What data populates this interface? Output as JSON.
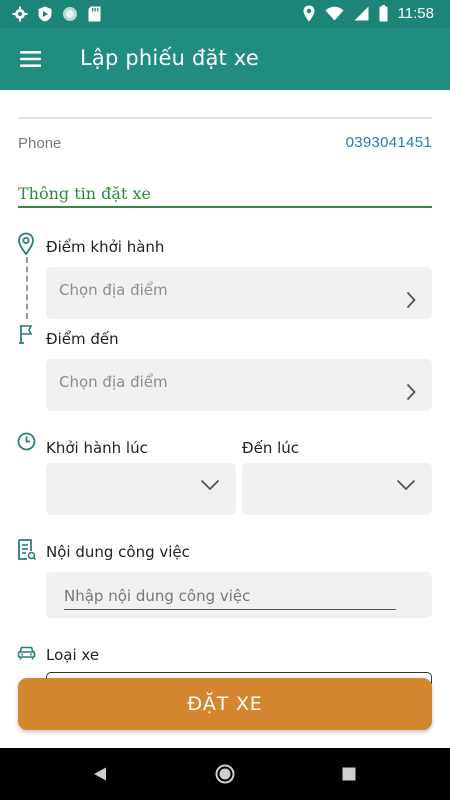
{
  "status_bar": {
    "time": "11:58",
    "icons_left": [
      "gear-icon",
      "shield-icon",
      "circle-icon",
      "sd-card-icon"
    ],
    "icons_right": [
      "location-icon",
      "wifi-icon",
      "signal-icon",
      "battery-icon"
    ]
  },
  "app_bar": {
    "title": "Lập phiếu đặt xe",
    "menu_icon": "hamburger-menu-icon"
  },
  "phone": {
    "label": "Phone",
    "value": "0393041451"
  },
  "booking_section": {
    "title": "Thông tin đặt xe"
  },
  "departure": {
    "label": "Điểm khởi hành",
    "placeholder": "Chọn địa điểm"
  },
  "destination": {
    "label": "Điểm đến",
    "placeholder": "Chọn địa điểm"
  },
  "times": {
    "depart_label": "Khởi hành lúc",
    "arrive_label": "Đến lúc"
  },
  "task": {
    "label": "Nội dung công việc",
    "placeholder": "Nhập nội dung công việc"
  },
  "vehicle": {
    "label": "Loại xe"
  },
  "submit": {
    "label": "ĐẶT XE"
  },
  "colors": {
    "status_bar": "#1d8478",
    "app_bar": "#218c80",
    "section_green": "#2f8d3d",
    "phone_blue": "#1f7fb6",
    "button_orange": "#d48630",
    "field_bg": "#f1f1f1"
  }
}
